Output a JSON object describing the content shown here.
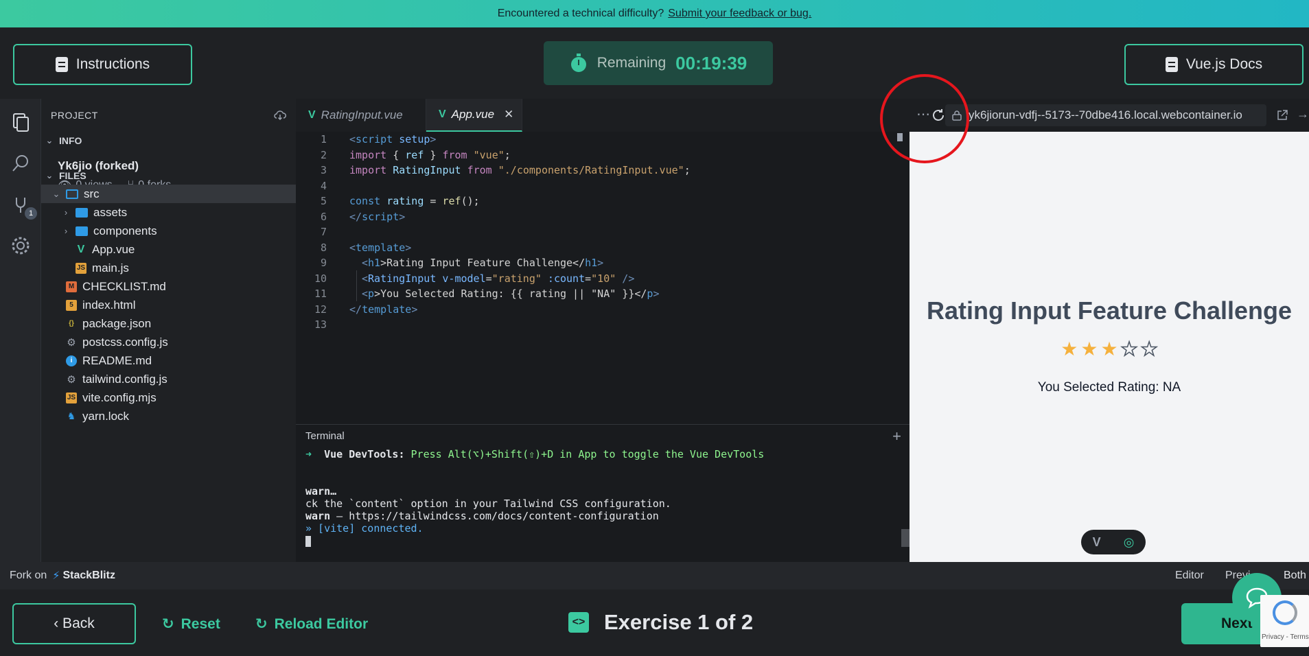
{
  "banner": {
    "text": "Encountered a technical difficulty?",
    "link": "Submit your feedback or bug."
  },
  "header": {
    "instructions_label": "Instructions",
    "timer_label": "Remaining",
    "timer_value": "00:19:39",
    "docs_label": "Vue.js Docs"
  },
  "activity_bar": {
    "badge": "1",
    "icons": [
      "files-icon",
      "search-icon",
      "plug-icon",
      "gear-icon"
    ]
  },
  "sidebar": {
    "title": "PROJECT",
    "info_section": "INFO",
    "project_name": "Yk6jio (forked)",
    "views": "0 views",
    "forks": "0 forks",
    "files_section": "FILES",
    "tree": [
      {
        "name": "src",
        "type": "folder-open",
        "depth": 0
      },
      {
        "name": "assets",
        "type": "folder",
        "depth": 1
      },
      {
        "name": "components",
        "type": "folder",
        "depth": 1
      },
      {
        "name": "App.vue",
        "type": "vue",
        "depth": 1
      },
      {
        "name": "main.js",
        "type": "js",
        "depth": 1
      },
      {
        "name": "CHECKLIST.md",
        "type": "md",
        "depth": 0
      },
      {
        "name": "index.html",
        "type": "html",
        "depth": 0
      },
      {
        "name": "package.json",
        "type": "json",
        "depth": 0
      },
      {
        "name": "postcss.config.js",
        "type": "config",
        "depth": 0
      },
      {
        "name": "README.md",
        "type": "info",
        "depth": 0
      },
      {
        "name": "tailwind.config.js",
        "type": "config",
        "depth": 0
      },
      {
        "name": "vite.config.mjs",
        "type": "js",
        "depth": 0
      },
      {
        "name": "yarn.lock",
        "type": "yarn",
        "depth": 0
      }
    ]
  },
  "editor": {
    "tabs": [
      {
        "label": "RatingInput.vue",
        "active": false
      },
      {
        "label": "App.vue",
        "active": true
      }
    ],
    "line_numbers": [
      "1",
      "2",
      "3",
      "4",
      "5",
      "6",
      "7",
      "8",
      "9",
      "10",
      "11",
      "12",
      "13"
    ],
    "code": {
      "l1": [
        "<",
        "script",
        " setup",
        ">"
      ],
      "l2": [
        "import",
        " { ",
        "ref",
        " } ",
        "from",
        " \"vue\"",
        ";"
      ],
      "l3": [
        "import",
        " ",
        "RatingInput",
        " ",
        "from",
        " \"./components/RatingInput.vue\"",
        ";"
      ],
      "l5": [
        "const",
        " ",
        "rating",
        " = ",
        "ref",
        "();"
      ],
      "l6": [
        "</",
        "script",
        ">"
      ],
      "l8": [
        "<",
        "template",
        ">"
      ],
      "l9": [
        "<",
        "h1",
        ">Rating Input Feature Challenge</",
        "h1",
        ">"
      ],
      "l10": [
        "<",
        "RatingInput",
        " v-model",
        "=",
        "\"rating\"",
        " :count",
        "=",
        "\"10\"",
        " />"
      ],
      "l11": [
        "<",
        "p",
        ">You Selected Rating: {{ rating || \"NA\" }}</",
        "p",
        ">"
      ],
      "l12": [
        "</",
        "template",
        ">"
      ]
    }
  },
  "terminal": {
    "title": "Terminal",
    "line1_arrow": "➜",
    "line1_label": "Vue DevTools:",
    "line1_text": "Press Alt(⌥)+Shift(⇧)+D in App to toggle the Vue DevTools",
    "line2": "warn…",
    "line3": "ck the `content` option in your Tailwind CSS configuration.",
    "line4_warn": "warn",
    "line4_text": " – https://tailwindcss.com/docs/content-configuration",
    "line5": "» [vite] connected."
  },
  "preview": {
    "url": "yk6jiorun-vdfj--5173--70dbe416.local.webcontainer.io",
    "heading": "Rating Input Feature Challenge",
    "stars_filled": 3,
    "stars_total": 5,
    "selected_text": "You Selected Rating: NA"
  },
  "status_bar": {
    "fork_on": "Fork on",
    "brand": "StackBlitz",
    "editor": "Editor",
    "preview": "Previ",
    "both": "Both"
  },
  "footer": {
    "back_label": "‹ Back",
    "reset_label": "Reset",
    "reload_label": "Reload Editor",
    "exercise_label": "Exercise 1 of 2",
    "next_label": "Next"
  },
  "recaptcha": {
    "text": "Privacy - Terms"
  },
  "colors": {
    "accent": "#3cc9a0",
    "annotation": "#e5161d",
    "star": "#f5b13d"
  }
}
